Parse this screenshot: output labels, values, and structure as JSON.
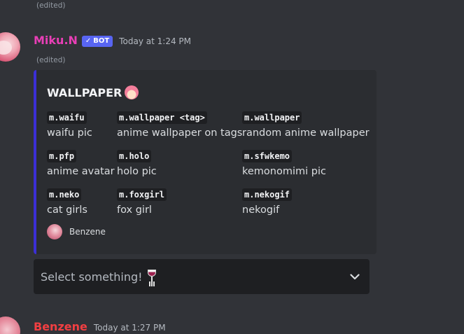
{
  "prev_message": {
    "edited_label": "(edited)"
  },
  "message": {
    "username": "Miku.N",
    "bot_badge": "BOT",
    "timestamp": "Today at 1:24 PM",
    "edited_label": "(edited)",
    "embed": {
      "title": "WALLPAPER",
      "title_emoji": "anime-girl-emoji",
      "accent_color": "#3b2fd6",
      "fields": [
        {
          "name": "m.waifu",
          "value": "waifu pic"
        },
        {
          "name": "m.wallpaper <tag>",
          "value": "anime wallpaper on tags"
        },
        {
          "name": "m.wallpaper",
          "value": "random anime wallpaper"
        },
        {
          "name": "m.pfp",
          "value": "anime avatar"
        },
        {
          "name": "m.holo",
          "value": "holo pic"
        },
        {
          "name": "m.sfwkemo",
          "value": "kemonomimi pic"
        },
        {
          "name": "m.neko",
          "value": "cat girls"
        },
        {
          "name": "m.foxgirl",
          "value": "fox girl"
        },
        {
          "name": "m.nekogif",
          "value": "nekogif"
        }
      ],
      "footer": {
        "text": "Benzene",
        "icon": "benzene-avatar"
      }
    },
    "select_menu": {
      "placeholder": "Select something!",
      "emoji": "wine-glass-emoji",
      "icon": "chevron-down-icon"
    }
  },
  "next_message": {
    "username": "Benzene",
    "timestamp": "Today at 1:27 PM"
  },
  "colors": {
    "background": "#313338",
    "embed_background": "#2b2d31",
    "miku_name": "#e83fb6",
    "benzene_name": "#f23f42",
    "bot_badge": "#5865f2",
    "select_background": "#1e1f22"
  }
}
